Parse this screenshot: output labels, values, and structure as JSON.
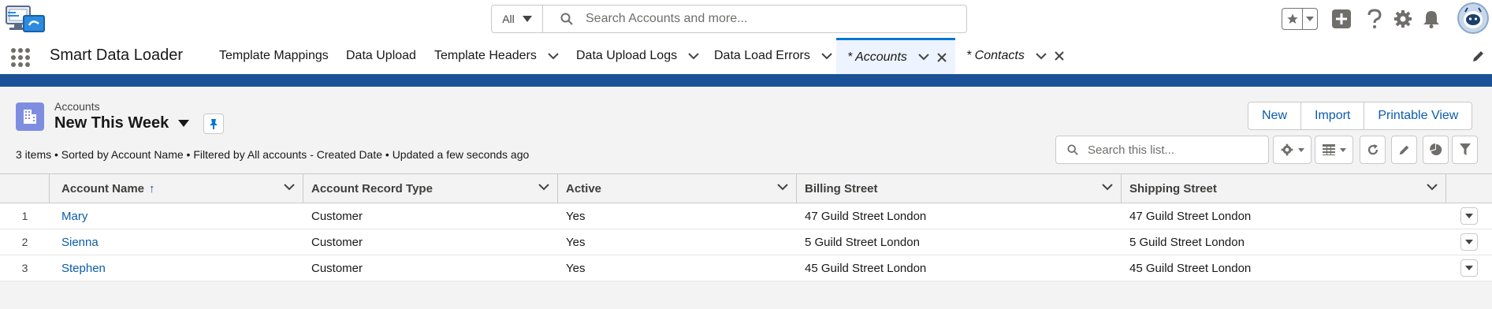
{
  "header": {
    "search_scope": "All",
    "search_placeholder": "Search Accounts and more..."
  },
  "nav": {
    "app_name": "Smart Data Loader",
    "tabs": [
      {
        "label": "Template Mappings"
      },
      {
        "label": "Data Upload"
      },
      {
        "label": "Template Headers"
      },
      {
        "label": "Data Upload Logs"
      },
      {
        "label": "Data Load Errors"
      },
      {
        "label": "* Accounts"
      },
      {
        "label": "* Contacts"
      }
    ],
    "active_tab": "* Accounts"
  },
  "list_view": {
    "object_label": "Accounts",
    "view_name": "New This Week",
    "meta": "3 items • Sorted by Account Name • Filtered by All accounts - Created Date • Updated a few seconds ago",
    "buttons": {
      "new": "New",
      "import": "Import",
      "printable": "Printable View"
    },
    "search_placeholder": "Search this list..."
  },
  "table": {
    "columns": [
      "Account Name",
      "Account Record Type",
      "Active",
      "Billing Street",
      "Shipping Street"
    ],
    "sort_indicator": "↑",
    "rows": [
      {
        "num": "1",
        "name": "Mary",
        "record_type": "Customer",
        "active": "Yes",
        "billing": "47 Guild Street London",
        "shipping": "47 Guild Street London"
      },
      {
        "num": "2",
        "name": "Sienna",
        "record_type": "Customer",
        "active": "Yes",
        "billing": "5 Guild Street London",
        "shipping": "5 Guild Street London"
      },
      {
        "num": "3",
        "name": "Stephen",
        "record_type": "Customer",
        "active": "Yes",
        "billing": "45 Guild Street London",
        "shipping": "45 Guild Street London"
      }
    ]
  },
  "colors": {
    "brand_band": "#1b5297",
    "link": "#0b5cab",
    "object_icon": "#7f8de1",
    "active_tab_bar": "#0176d3"
  }
}
